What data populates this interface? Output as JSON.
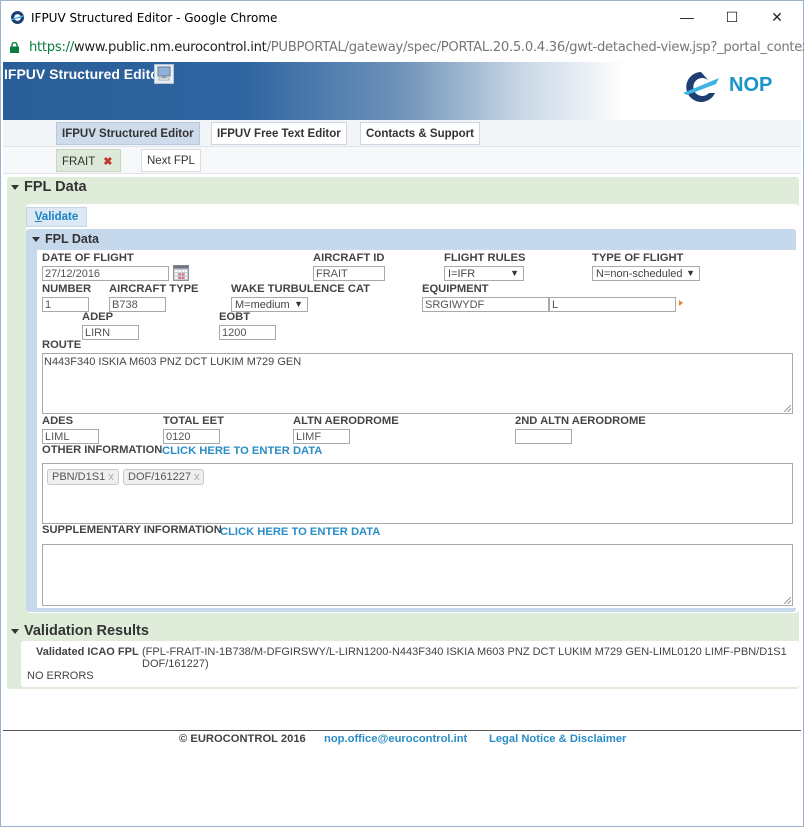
{
  "window": {
    "title": "IFPUV Structured Editor - Google Chrome",
    "controls": {
      "minimize": "—",
      "maximize": "☐",
      "close": "✕"
    }
  },
  "address_bar": {
    "scheme": "https://",
    "host_prefix": "www.public.nm.",
    "host_domain": "eurocontrol.int",
    "path": "/PUBPORTAL/gateway/spec/PORTAL.20.5.0.4.36/gwt-detached-view.jsp?_portal_contex"
  },
  "banner": {
    "title": "IFPUV Structured Editor",
    "logo_text": "NOP"
  },
  "nav_tabs": [
    {
      "label": "IFPUV Structured Editor",
      "active": true
    },
    {
      "label": "IFPUV Free Text Editor",
      "active": false
    },
    {
      "label": "Contacts & Support",
      "active": false
    }
  ],
  "sub_tabs": [
    {
      "label": "FRAIT",
      "active": true,
      "closable": true
    },
    {
      "label": "Next FPL",
      "active": false,
      "closable": false
    }
  ],
  "fpl_section": {
    "heading": "FPL Data",
    "validate_button": {
      "accesskey": "V",
      "rest": "alidate"
    },
    "panel_heading": "FPL Data",
    "fields": {
      "date_of_flight": {
        "label": "DATE OF FLIGHT",
        "value": "27/12/2016"
      },
      "aircraft_id": {
        "label": "AIRCRAFT ID",
        "value": "FRAIT"
      },
      "flight_rules": {
        "label": "FLIGHT RULES",
        "value": "I=IFR"
      },
      "type_of_flight": {
        "label": "TYPE OF FLIGHT",
        "value": "N=non-scheduled"
      },
      "number": {
        "label": "NUMBER",
        "value": "1"
      },
      "aircraft_type": {
        "label": "AIRCRAFT TYPE",
        "value": "B738"
      },
      "wake_turbulence": {
        "label": "WAKE TURBULENCE CAT",
        "value": "M=medium"
      },
      "equipment": {
        "label": "EQUIPMENT",
        "value": "SRGIWYDF",
        "value2": "L"
      },
      "adep": {
        "label": "ADEP",
        "value": "LIRN"
      },
      "eobt": {
        "label": "EOBT",
        "value": "1200"
      },
      "route": {
        "label": "ROUTE",
        "value": "N443F340 ISKIA M603 PNZ DCT LUKIM M729 GEN"
      },
      "ades": {
        "label": "ADES",
        "value": "LIML"
      },
      "total_eet": {
        "label": "TOTAL EET",
        "value": "0120"
      },
      "altn_aerodrome": {
        "label": "ALTN AERODROME",
        "value": "LIMF"
      },
      "altn2_aerodrome": {
        "label": "2ND ALTN AERODROME",
        "value": ""
      },
      "other_information": {
        "label": "OTHER INFORMATION",
        "link": "CLICK HERE TO ENTER DATA",
        "chips": [
          "PBN/D1S1",
          "DOF/161227"
        ]
      },
      "supplementary_information": {
        "label": "SUPPLEMENTARY INFORMATION",
        "link": "CLICK HERE TO ENTER DATA",
        "value": ""
      }
    }
  },
  "validation": {
    "heading": "Validation Results",
    "icao_label": "Validated ICAO FPL",
    "icao_line1": "(FPL-FRAIT-IN-1B738/M-DFGIRSWY/L-LIRN1200-N443F340 ISKIA M603 PNZ DCT LUKIM M729 GEN-LIML0120 LIMF-PBN/D1S1",
    "icao_line2": "DOF/161227)",
    "status": "NO ERRORS"
  },
  "footer": {
    "copyright": "© EUROCONTROL 2016",
    "email": "nop.office@eurocontrol.int",
    "legal": "Legal Notice & Disclaimer"
  },
  "colors": {
    "banner_blue": "#2a5e98",
    "link_blue": "#2a8dc6",
    "section_green": "#deecd9",
    "panel_blue": "#c6d8ec",
    "logo_blue": "#1b95c8"
  }
}
